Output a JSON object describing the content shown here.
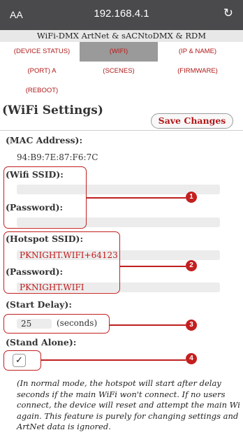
{
  "browser": {
    "text_size_label": "AA",
    "url": "192.168.4.1",
    "reload_glyph": "↻"
  },
  "header": {
    "title": "WiFi-DMX ArtNet & sACNtoDMX & RDM"
  },
  "nav": {
    "device_status": "(DEVICE STATUS)",
    "wifi": "(WIFI)",
    "ip_name": "(IP & NAME)",
    "port_a": "(PORT) A",
    "scenes": "(SCENES)",
    "firmware": "(FIRMWARE)",
    "reboot": "(REBOOT)",
    "active": "wifi"
  },
  "page": {
    "title": "(WiFi Settings)",
    "save_label": "Save Changes"
  },
  "mac": {
    "label": "(MAC Address):",
    "value": "94:B9:7E:87:F6:7C"
  },
  "wifi": {
    "ssid_label": "(Wifi SSID):",
    "ssid_value": "",
    "password_label": "(Password):",
    "password_value": ""
  },
  "hotspot": {
    "ssid_label": "(Hotspot SSID):",
    "ssid_value": "PKNIGHT.WIFI+64123",
    "password_label": "(Password):",
    "password_value": "PKNIGHT.WIFI"
  },
  "start_delay": {
    "label": "(Start Delay):",
    "value": "25",
    "unit": "(seconds)"
  },
  "stand_alone": {
    "label": "(Stand Alone):",
    "checked": true,
    "check_glyph": "✓"
  },
  "callouts": [
    "1",
    "2",
    "3",
    "4"
  ],
  "note": "(In normal mode, the hotspot will start after delay seconds if the main WiFi won't connect. If no users connect, the device will reset and attempt the main Wi again. This feature is purely for changing settings and ArtNet data is ignored.",
  "colors": {
    "accent": "#b01818",
    "callout": "#c41f1f",
    "topbar": "#4a4a4c"
  }
}
